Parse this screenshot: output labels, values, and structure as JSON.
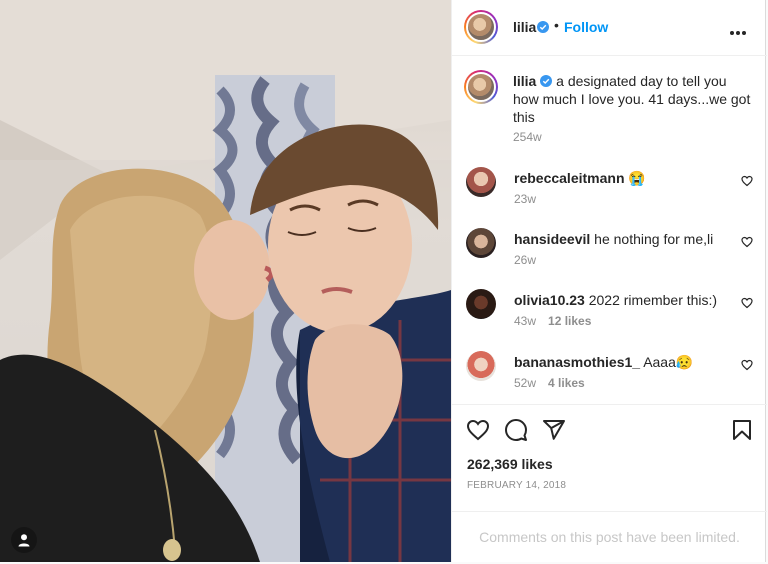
{
  "header": {
    "username": "lilia",
    "separator": "•",
    "follow_label": "Follow"
  },
  "caption": {
    "username": "lilia",
    "text": "a designated day to tell you how much I love you. 41 days...we got this",
    "time": "254w"
  },
  "comments": [
    {
      "username": "rebeccaleitmann",
      "text": "😭",
      "time": "23w",
      "likes": ""
    },
    {
      "username": "hansideevil",
      "text": "he nothing for me,li",
      "time": "26w",
      "likes": ""
    },
    {
      "username": "olivia10.23",
      "text": "2022 rimember this:)",
      "time": "43w",
      "likes": "12 likes"
    },
    {
      "username": "bananasmothies1_",
      "text": "Aaaa😥",
      "time": "52w",
      "likes": "4 likes"
    }
  ],
  "stats": {
    "likes": "262,369 likes",
    "date": "FEBRUARY 14, 2018"
  },
  "footer": {
    "limited_text": "Comments on this post have been limited."
  },
  "icons": {
    "more": "more-options-icon",
    "verified": "verified-badge-icon",
    "like": "heart-icon",
    "comment": "comment-icon",
    "share": "share-icon",
    "save": "bookmark-icon",
    "tag": "user-tag-icon"
  },
  "colors": {
    "accent": "#0095f6",
    "text": "#262626",
    "muted": "#8e8e8e",
    "border": "#efefef"
  }
}
